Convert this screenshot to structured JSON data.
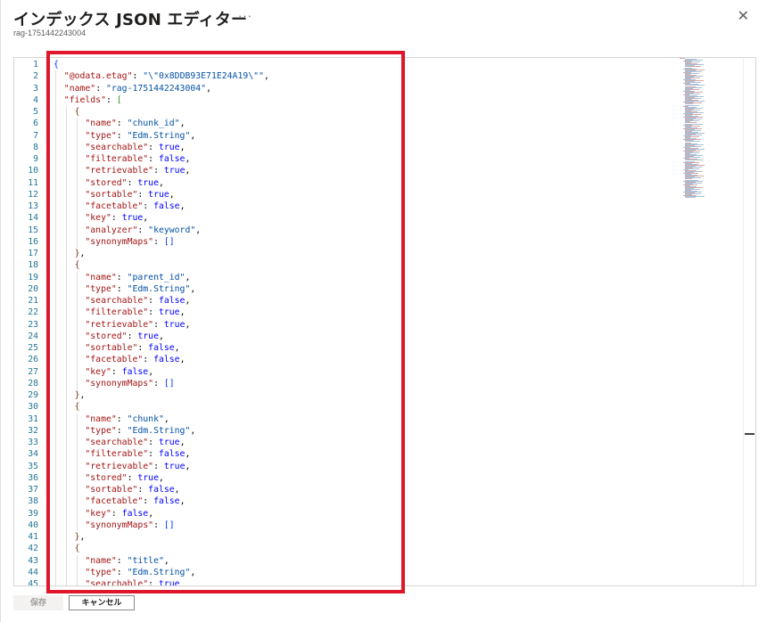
{
  "header": {
    "title": "インデックス JSON エディター",
    "more_label": "···",
    "subtitle": "rag-1751442243004",
    "close_label": "✕"
  },
  "editor": {
    "lines": [
      {
        "n": "1",
        "indent": 0,
        "tokens": [
          [
            "br1",
            "{"
          ]
        ]
      },
      {
        "n": "2",
        "indent": 1,
        "tokens": [
          [
            "k",
            "\"@odata.etag\""
          ],
          [
            "p",
            ": "
          ],
          [
            "s",
            "\"\\\"0x8DDB93E71E24A19\\\"\""
          ],
          [
            "p",
            ","
          ]
        ]
      },
      {
        "n": "3",
        "indent": 1,
        "tokens": [
          [
            "k",
            "\"name\""
          ],
          [
            "p",
            ": "
          ],
          [
            "s",
            "\"rag-1751442243004\""
          ],
          [
            "p",
            ","
          ]
        ]
      },
      {
        "n": "4",
        "indent": 1,
        "tokens": [
          [
            "k",
            "\"fields\""
          ],
          [
            "p",
            ": "
          ],
          [
            "br2",
            "["
          ]
        ]
      },
      {
        "n": "5",
        "indent": 2,
        "tokens": [
          [
            "br3",
            "{"
          ]
        ]
      },
      {
        "n": "6",
        "indent": 3,
        "tokens": [
          [
            "k",
            "\"name\""
          ],
          [
            "p",
            ": "
          ],
          [
            "s",
            "\"chunk_id\""
          ],
          [
            "p",
            ","
          ]
        ]
      },
      {
        "n": "7",
        "indent": 3,
        "tokens": [
          [
            "k",
            "\"type\""
          ],
          [
            "p",
            ": "
          ],
          [
            "s",
            "\"Edm.String\""
          ],
          [
            "p",
            ","
          ]
        ]
      },
      {
        "n": "8",
        "indent": 3,
        "tokens": [
          [
            "k",
            "\"searchable\""
          ],
          [
            "p",
            ": "
          ],
          [
            "b",
            "true"
          ],
          [
            "p",
            ","
          ]
        ]
      },
      {
        "n": "9",
        "indent": 3,
        "tokens": [
          [
            "k",
            "\"filterable\""
          ],
          [
            "p",
            ": "
          ],
          [
            "b",
            "false"
          ],
          [
            "p",
            ","
          ]
        ]
      },
      {
        "n": "10",
        "indent": 3,
        "tokens": [
          [
            "k",
            "\"retrievable\""
          ],
          [
            "p",
            ": "
          ],
          [
            "b",
            "true"
          ],
          [
            "p",
            ","
          ]
        ]
      },
      {
        "n": "11",
        "indent": 3,
        "tokens": [
          [
            "k",
            "\"stored\""
          ],
          [
            "p",
            ": "
          ],
          [
            "b",
            "true"
          ],
          [
            "p",
            ","
          ]
        ]
      },
      {
        "n": "12",
        "indent": 3,
        "tokens": [
          [
            "k",
            "\"sortable\""
          ],
          [
            "p",
            ": "
          ],
          [
            "b",
            "true"
          ],
          [
            "p",
            ","
          ]
        ]
      },
      {
        "n": "13",
        "indent": 3,
        "tokens": [
          [
            "k",
            "\"facetable\""
          ],
          [
            "p",
            ": "
          ],
          [
            "b",
            "false"
          ],
          [
            "p",
            ","
          ]
        ]
      },
      {
        "n": "14",
        "indent": 3,
        "tokens": [
          [
            "k",
            "\"key\""
          ],
          [
            "p",
            ": "
          ],
          [
            "b",
            "true"
          ],
          [
            "p",
            ","
          ]
        ]
      },
      {
        "n": "15",
        "indent": 3,
        "tokens": [
          [
            "k",
            "\"analyzer\""
          ],
          [
            "p",
            ": "
          ],
          [
            "s",
            "\"keyword\""
          ],
          [
            "p",
            ","
          ]
        ]
      },
      {
        "n": "16",
        "indent": 3,
        "tokens": [
          [
            "k",
            "\"synonymMaps\""
          ],
          [
            "p",
            ": "
          ],
          [
            "br1",
            "[]"
          ]
        ]
      },
      {
        "n": "17",
        "indent": 2,
        "tokens": [
          [
            "br3",
            "}"
          ],
          [
            "p",
            ","
          ]
        ]
      },
      {
        "n": "18",
        "indent": 2,
        "tokens": [
          [
            "br3",
            "{"
          ]
        ]
      },
      {
        "n": "19",
        "indent": 3,
        "tokens": [
          [
            "k",
            "\"name\""
          ],
          [
            "p",
            ": "
          ],
          [
            "s",
            "\"parent_id\""
          ],
          [
            "p",
            ","
          ]
        ]
      },
      {
        "n": "20",
        "indent": 3,
        "tokens": [
          [
            "k",
            "\"type\""
          ],
          [
            "p",
            ": "
          ],
          [
            "s",
            "\"Edm.String\""
          ],
          [
            "p",
            ","
          ]
        ]
      },
      {
        "n": "21",
        "indent": 3,
        "tokens": [
          [
            "k",
            "\"searchable\""
          ],
          [
            "p",
            ": "
          ],
          [
            "b",
            "false"
          ],
          [
            "p",
            ","
          ]
        ]
      },
      {
        "n": "22",
        "indent": 3,
        "tokens": [
          [
            "k",
            "\"filterable\""
          ],
          [
            "p",
            ": "
          ],
          [
            "b",
            "true"
          ],
          [
            "p",
            ","
          ]
        ]
      },
      {
        "n": "23",
        "indent": 3,
        "tokens": [
          [
            "k",
            "\"retrievable\""
          ],
          [
            "p",
            ": "
          ],
          [
            "b",
            "true"
          ],
          [
            "p",
            ","
          ]
        ]
      },
      {
        "n": "24",
        "indent": 3,
        "tokens": [
          [
            "k",
            "\"stored\""
          ],
          [
            "p",
            ": "
          ],
          [
            "b",
            "true"
          ],
          [
            "p",
            ","
          ]
        ]
      },
      {
        "n": "25",
        "indent": 3,
        "tokens": [
          [
            "k",
            "\"sortable\""
          ],
          [
            "p",
            ": "
          ],
          [
            "b",
            "false"
          ],
          [
            "p",
            ","
          ]
        ]
      },
      {
        "n": "26",
        "indent": 3,
        "tokens": [
          [
            "k",
            "\"facetable\""
          ],
          [
            "p",
            ": "
          ],
          [
            "b",
            "false"
          ],
          [
            "p",
            ","
          ]
        ]
      },
      {
        "n": "27",
        "indent": 3,
        "tokens": [
          [
            "k",
            "\"key\""
          ],
          [
            "p",
            ": "
          ],
          [
            "b",
            "false"
          ],
          [
            "p",
            ","
          ]
        ]
      },
      {
        "n": "28",
        "indent": 3,
        "tokens": [
          [
            "k",
            "\"synonymMaps\""
          ],
          [
            "p",
            ": "
          ],
          [
            "br1",
            "[]"
          ]
        ]
      },
      {
        "n": "29",
        "indent": 2,
        "tokens": [
          [
            "br3",
            "}"
          ],
          [
            "p",
            ","
          ]
        ]
      },
      {
        "n": "30",
        "indent": 2,
        "tokens": [
          [
            "br3",
            "{"
          ]
        ]
      },
      {
        "n": "31",
        "indent": 3,
        "tokens": [
          [
            "k",
            "\"name\""
          ],
          [
            "p",
            ": "
          ],
          [
            "s",
            "\"chunk\""
          ],
          [
            "p",
            ","
          ]
        ]
      },
      {
        "n": "32",
        "indent": 3,
        "tokens": [
          [
            "k",
            "\"type\""
          ],
          [
            "p",
            ": "
          ],
          [
            "s",
            "\"Edm.String\""
          ],
          [
            "p",
            ","
          ]
        ]
      },
      {
        "n": "33",
        "indent": 3,
        "tokens": [
          [
            "k",
            "\"searchable\""
          ],
          [
            "p",
            ": "
          ],
          [
            "b",
            "true"
          ],
          [
            "p",
            ","
          ]
        ]
      },
      {
        "n": "34",
        "indent": 3,
        "tokens": [
          [
            "k",
            "\"filterable\""
          ],
          [
            "p",
            ": "
          ],
          [
            "b",
            "false"
          ],
          [
            "p",
            ","
          ]
        ]
      },
      {
        "n": "35",
        "indent": 3,
        "tokens": [
          [
            "k",
            "\"retrievable\""
          ],
          [
            "p",
            ": "
          ],
          [
            "b",
            "true"
          ],
          [
            "p",
            ","
          ]
        ]
      },
      {
        "n": "36",
        "indent": 3,
        "tokens": [
          [
            "k",
            "\"stored\""
          ],
          [
            "p",
            ": "
          ],
          [
            "b",
            "true"
          ],
          [
            "p",
            ","
          ]
        ]
      },
      {
        "n": "37",
        "indent": 3,
        "tokens": [
          [
            "k",
            "\"sortable\""
          ],
          [
            "p",
            ": "
          ],
          [
            "b",
            "false"
          ],
          [
            "p",
            ","
          ]
        ]
      },
      {
        "n": "38",
        "indent": 3,
        "tokens": [
          [
            "k",
            "\"facetable\""
          ],
          [
            "p",
            ": "
          ],
          [
            "b",
            "false"
          ],
          [
            "p",
            ","
          ]
        ]
      },
      {
        "n": "39",
        "indent": 3,
        "tokens": [
          [
            "k",
            "\"key\""
          ],
          [
            "p",
            ": "
          ],
          [
            "b",
            "false"
          ],
          [
            "p",
            ","
          ]
        ]
      },
      {
        "n": "40",
        "indent": 3,
        "tokens": [
          [
            "k",
            "\"synonymMaps\""
          ],
          [
            "p",
            ": "
          ],
          [
            "br1",
            "[]"
          ]
        ]
      },
      {
        "n": "41",
        "indent": 2,
        "tokens": [
          [
            "br3",
            "}"
          ],
          [
            "p",
            ","
          ]
        ]
      },
      {
        "n": "42",
        "indent": 2,
        "tokens": [
          [
            "br3",
            "{"
          ]
        ]
      },
      {
        "n": "43",
        "indent": 3,
        "tokens": [
          [
            "k",
            "\"name\""
          ],
          [
            "p",
            ": "
          ],
          [
            "s",
            "\"title\""
          ],
          [
            "p",
            ","
          ]
        ]
      },
      {
        "n": "44",
        "indent": 3,
        "tokens": [
          [
            "k",
            "\"type\""
          ],
          [
            "p",
            ": "
          ],
          [
            "s",
            "\"Edm.String\""
          ],
          [
            "p",
            ","
          ]
        ]
      },
      {
        "n": "45",
        "indent": 3,
        "tokens": [
          [
            "k",
            "\"searchable\""
          ],
          [
            "p",
            ": "
          ],
          [
            "b",
            "true"
          ]
        ]
      }
    ]
  },
  "footer": {
    "save_label": "保存",
    "cancel_label": "キャンセル"
  },
  "colors": {
    "highlight_border": "#e0162b",
    "line_number": "#237893",
    "key": "#a31515",
    "string": "#0451a5",
    "boolean": "#0000ff"
  }
}
